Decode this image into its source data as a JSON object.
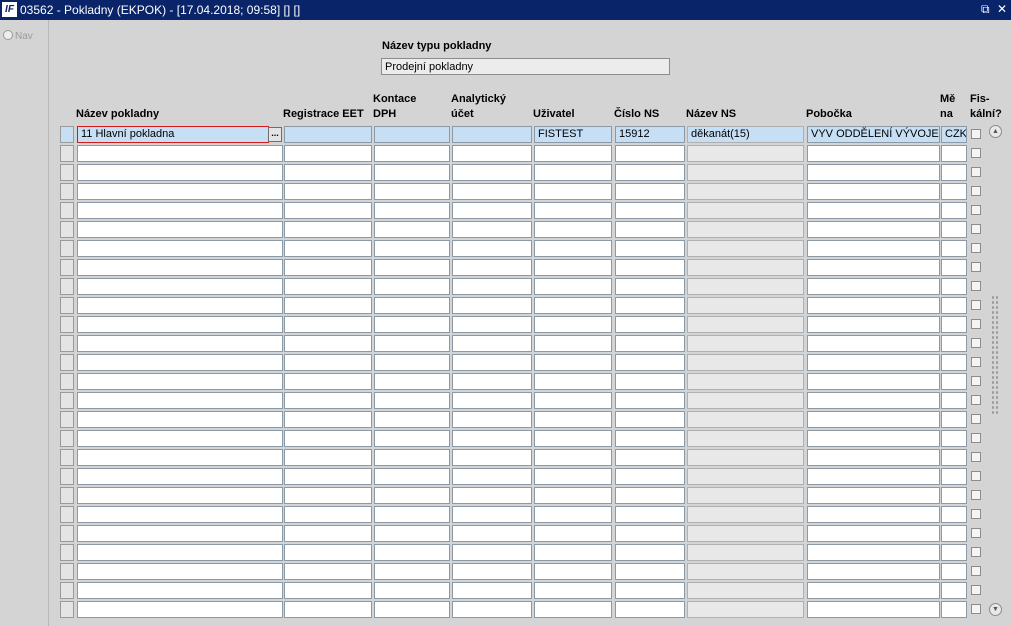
{
  "window": {
    "app_icon_text": "IF",
    "title": "03562 - Pokladny (EKPOK) - [17.04.2018; 09:58]  []  []",
    "restore_glyph": "⧉",
    "close_glyph": "✕"
  },
  "nav": {
    "label": "Nav"
  },
  "type": {
    "label": "Název typu pokladny",
    "value": "Prodejní pokladny"
  },
  "columns": {
    "nazev": "Název pokladny",
    "eet": "Registrace EET",
    "kontace": "Kontace\nDPH",
    "analyticky": "Analytický\núčet",
    "uzivatel": "Uživatel",
    "cislo_ns": "Číslo NS",
    "nazev_ns": "Název NS",
    "pobocka": "Pobočka",
    "mena": "Mě\nna",
    "fiskalni": "Fis-\nkální?"
  },
  "rows": [
    {
      "nazev": "11 Hlavní pokladna",
      "eet": "",
      "kontace": "",
      "analyticky": "",
      "uzivatel": "FISTEST",
      "cislo_ns": "15912",
      "nazev_ns": "děkanát(15)",
      "pobocka": "VYV ODDĚLENÍ VÝVOJE A",
      "mena": "CZK",
      "fiskalni": false
    },
    {
      "nazev": "",
      "eet": "",
      "kontace": "",
      "analyticky": "",
      "uzivatel": "",
      "cislo_ns": "",
      "nazev_ns": "",
      "pobocka": "",
      "mena": "",
      "fiskalni": false
    },
    {
      "nazev": "",
      "eet": "",
      "kontace": "",
      "analyticky": "",
      "uzivatel": "",
      "cislo_ns": "",
      "nazev_ns": "",
      "pobocka": "",
      "mena": "",
      "fiskalni": false
    },
    {
      "nazev": "",
      "eet": "",
      "kontace": "",
      "analyticky": "",
      "uzivatel": "",
      "cislo_ns": "",
      "nazev_ns": "",
      "pobocka": "",
      "mena": "",
      "fiskalni": false
    },
    {
      "nazev": "",
      "eet": "",
      "kontace": "",
      "analyticky": "",
      "uzivatel": "",
      "cislo_ns": "",
      "nazev_ns": "",
      "pobocka": "",
      "mena": "",
      "fiskalni": false
    },
    {
      "nazev": "",
      "eet": "",
      "kontace": "",
      "analyticky": "",
      "uzivatel": "",
      "cislo_ns": "",
      "nazev_ns": "",
      "pobocka": "",
      "mena": "",
      "fiskalni": false
    },
    {
      "nazev": "",
      "eet": "",
      "kontace": "",
      "analyticky": "",
      "uzivatel": "",
      "cislo_ns": "",
      "nazev_ns": "",
      "pobocka": "",
      "mena": "",
      "fiskalni": false
    },
    {
      "nazev": "",
      "eet": "",
      "kontace": "",
      "analyticky": "",
      "uzivatel": "",
      "cislo_ns": "",
      "nazev_ns": "",
      "pobocka": "",
      "mena": "",
      "fiskalni": false
    },
    {
      "nazev": "",
      "eet": "",
      "kontace": "",
      "analyticky": "",
      "uzivatel": "",
      "cislo_ns": "",
      "nazev_ns": "",
      "pobocka": "",
      "mena": "",
      "fiskalni": false
    },
    {
      "nazev": "",
      "eet": "",
      "kontace": "",
      "analyticky": "",
      "uzivatel": "",
      "cislo_ns": "",
      "nazev_ns": "",
      "pobocka": "",
      "mena": "",
      "fiskalni": false
    },
    {
      "nazev": "",
      "eet": "",
      "kontace": "",
      "analyticky": "",
      "uzivatel": "",
      "cislo_ns": "",
      "nazev_ns": "",
      "pobocka": "",
      "mena": "",
      "fiskalni": false
    },
    {
      "nazev": "",
      "eet": "",
      "kontace": "",
      "analyticky": "",
      "uzivatel": "",
      "cislo_ns": "",
      "nazev_ns": "",
      "pobocka": "",
      "mena": "",
      "fiskalni": false
    },
    {
      "nazev": "",
      "eet": "",
      "kontace": "",
      "analyticky": "",
      "uzivatel": "",
      "cislo_ns": "",
      "nazev_ns": "",
      "pobocka": "",
      "mena": "",
      "fiskalni": false
    },
    {
      "nazev": "",
      "eet": "",
      "kontace": "",
      "analyticky": "",
      "uzivatel": "",
      "cislo_ns": "",
      "nazev_ns": "",
      "pobocka": "",
      "mena": "",
      "fiskalni": false
    },
    {
      "nazev": "",
      "eet": "",
      "kontace": "",
      "analyticky": "",
      "uzivatel": "",
      "cislo_ns": "",
      "nazev_ns": "",
      "pobocka": "",
      "mena": "",
      "fiskalni": false
    },
    {
      "nazev": "",
      "eet": "",
      "kontace": "",
      "analyticky": "",
      "uzivatel": "",
      "cislo_ns": "",
      "nazev_ns": "",
      "pobocka": "",
      "mena": "",
      "fiskalni": false
    },
    {
      "nazev": "",
      "eet": "",
      "kontace": "",
      "analyticky": "",
      "uzivatel": "",
      "cislo_ns": "",
      "nazev_ns": "",
      "pobocka": "",
      "mena": "",
      "fiskalni": false
    },
    {
      "nazev": "",
      "eet": "",
      "kontace": "",
      "analyticky": "",
      "uzivatel": "",
      "cislo_ns": "",
      "nazev_ns": "",
      "pobocka": "",
      "mena": "",
      "fiskalni": false
    },
    {
      "nazev": "",
      "eet": "",
      "kontace": "",
      "analyticky": "",
      "uzivatel": "",
      "cislo_ns": "",
      "nazev_ns": "",
      "pobocka": "",
      "mena": "",
      "fiskalni": false
    },
    {
      "nazev": "",
      "eet": "",
      "kontace": "",
      "analyticky": "",
      "uzivatel": "",
      "cislo_ns": "",
      "nazev_ns": "",
      "pobocka": "",
      "mena": "",
      "fiskalni": false
    },
    {
      "nazev": "",
      "eet": "",
      "kontace": "",
      "analyticky": "",
      "uzivatel": "",
      "cislo_ns": "",
      "nazev_ns": "",
      "pobocka": "",
      "mena": "",
      "fiskalni": false
    },
    {
      "nazev": "",
      "eet": "",
      "kontace": "",
      "analyticky": "",
      "uzivatel": "",
      "cislo_ns": "",
      "nazev_ns": "",
      "pobocka": "",
      "mena": "",
      "fiskalni": false
    },
    {
      "nazev": "",
      "eet": "",
      "kontace": "",
      "analyticky": "",
      "uzivatel": "",
      "cislo_ns": "",
      "nazev_ns": "",
      "pobocka": "",
      "mena": "",
      "fiskalni": false
    },
    {
      "nazev": "",
      "eet": "",
      "kontace": "",
      "analyticky": "",
      "uzivatel": "",
      "cislo_ns": "",
      "nazev_ns": "",
      "pobocka": "",
      "mena": "",
      "fiskalni": false
    },
    {
      "nazev": "",
      "eet": "",
      "kontace": "",
      "analyticky": "",
      "uzivatel": "",
      "cislo_ns": "",
      "nazev_ns": "",
      "pobocka": "",
      "mena": "",
      "fiskalni": false
    },
    {
      "nazev": "",
      "eet": "",
      "kontace": "",
      "analyticky": "",
      "uzivatel": "",
      "cislo_ns": "",
      "nazev_ns": "",
      "pobocka": "",
      "mena": "",
      "fiskalni": false
    }
  ],
  "lov_button_label": "...",
  "scrollbar": {
    "up_glyph": "▲",
    "down_glyph": "▼"
  },
  "colors": {
    "titlebar": "#0a246a",
    "current_row": "#c6dff5",
    "active_border": "#d21a1a"
  }
}
